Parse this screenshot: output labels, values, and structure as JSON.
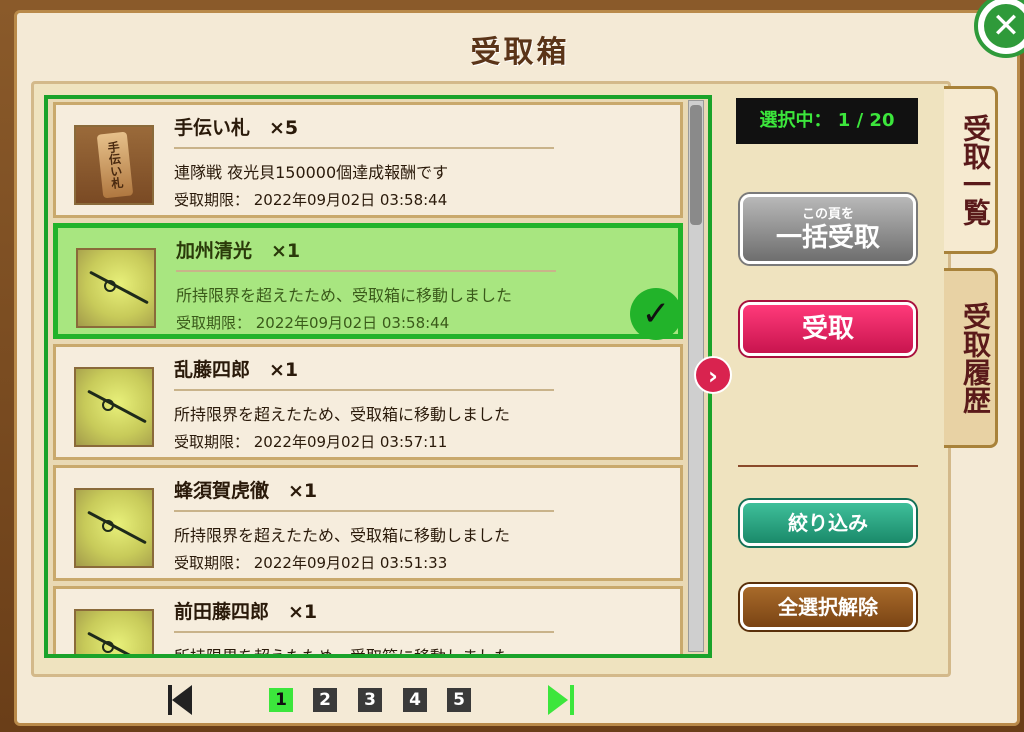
{
  "title": "受取箱",
  "counter": {
    "label": "選択中：",
    "value": "1 / 20"
  },
  "items": [
    {
      "name": "手伝い札　×5",
      "desc": "連隊戦 夜光貝150000個達成報酬です",
      "deadline": "受取期限： 2022年09月02日 03:58:44",
      "icon": "tag-icon",
      "thumb_text": "手伝い札",
      "selected": false
    },
    {
      "name": "加州清光　×1",
      "desc": "所持限界を超えたため、受取箱に移動しました",
      "deadline": "受取期限： 2022年09月02日 03:58:44",
      "icon": "sword-icon",
      "selected": true
    },
    {
      "name": "乱藤四郎　×1",
      "desc": "所持限界を超えたため、受取箱に移動しました",
      "deadline": "受取期限： 2022年09月02日 03:57:11",
      "icon": "sword-icon",
      "selected": false
    },
    {
      "name": "蜂須賀虎徹　×1",
      "desc": "所持限界を超えたため、受取箱に移動しました",
      "deadline": "受取期限： 2022年09月02日 03:51:33",
      "icon": "sword-icon",
      "selected": false
    },
    {
      "name": "前田藤四郎　×1",
      "desc": "所持限界を超えたため、受取箱に移動しました",
      "deadline": "",
      "icon": "sword-icon",
      "selected": false
    }
  ],
  "buttons": {
    "bulk_small": "この頁を",
    "bulk_big": "一括受取",
    "receive": "受取",
    "filter": "絞り込み",
    "deselect": "全選択解除"
  },
  "tabs": {
    "list": "受取一覧",
    "history": "受取履歴"
  },
  "pagination": {
    "pages": [
      "1",
      "2",
      "3",
      "4",
      "5"
    ],
    "current": "1"
  },
  "colors": {
    "accent_green": "#22b32a",
    "receive_pink": "#d9234f",
    "counter_green": "#3ce63c"
  }
}
